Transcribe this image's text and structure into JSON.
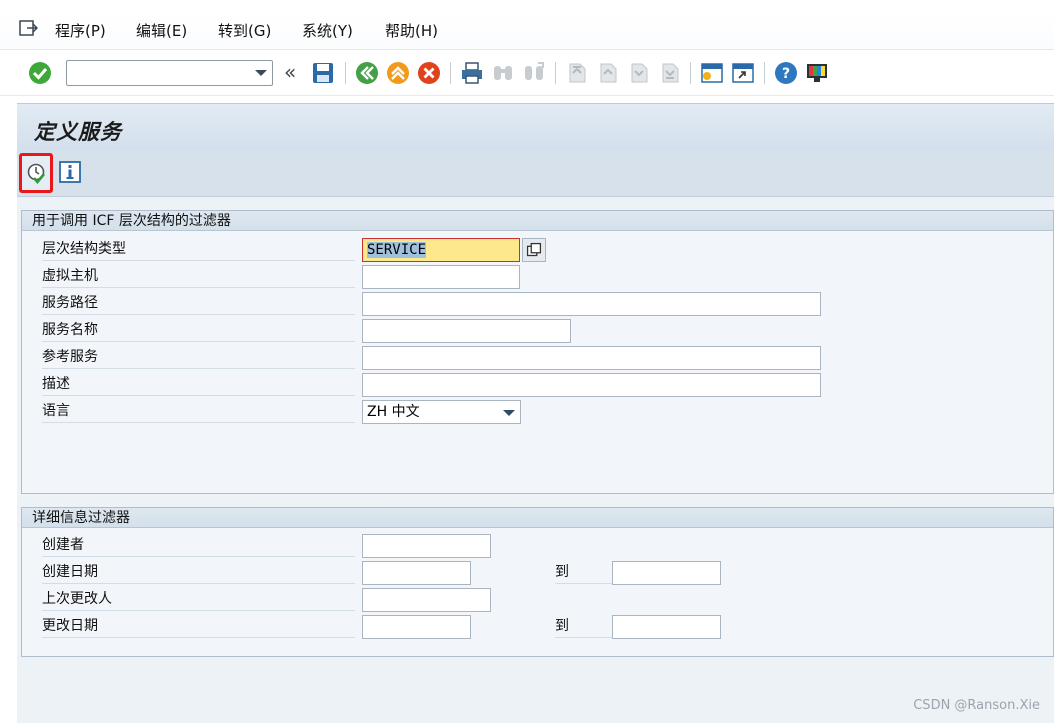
{
  "menu": {
    "items": [
      "程序(P)",
      "编辑(E)",
      "转到(G)",
      "系统(Y)",
      "帮助(H)"
    ]
  },
  "toolbar": {
    "command_field_value": "",
    "icons": [
      "enter-icon",
      "save-icon",
      "back-icon",
      "exit-icon",
      "cancel-icon",
      "print-icon",
      "find-icon",
      "find-next-icon",
      "first-page-icon",
      "prev-page-icon",
      "next-page-icon",
      "last-page-icon",
      "new-session-icon",
      "shortcut-icon",
      "help-icon",
      "customize-layout-icon"
    ]
  },
  "page": {
    "title": "定义服务"
  },
  "app_toolbar": {
    "icons": [
      "execute-icon",
      "info-icon"
    ]
  },
  "filter_group": {
    "title": "用于调用 ICF 层次结构的过滤器",
    "fields": [
      {
        "label": "层次结构类型",
        "value": "SERVICE"
      },
      {
        "label": "虚拟主机",
        "value": ""
      },
      {
        "label": "服务路径",
        "value": ""
      },
      {
        "label": "服务名称",
        "value": ""
      },
      {
        "label": "参考服务",
        "value": ""
      },
      {
        "label": "描述",
        "value": ""
      },
      {
        "label": "语言",
        "value": "ZH 中文"
      }
    ]
  },
  "detail_group": {
    "title": "详细信息过滤器",
    "to_label": "到",
    "fields": [
      {
        "label": "创建者",
        "value": ""
      },
      {
        "label": "创建日期",
        "value": "",
        "to_value": ""
      },
      {
        "label": "上次更改人",
        "value": ""
      },
      {
        "label": "更改日期",
        "value": "",
        "to_value": ""
      }
    ]
  },
  "footer": {
    "text": "CSDN @Ranson.Xie"
  },
  "colors": {
    "highlight_border": "#e8171c",
    "required_field_bg": "#fde98b",
    "panel_bg": "#edf2f7"
  }
}
